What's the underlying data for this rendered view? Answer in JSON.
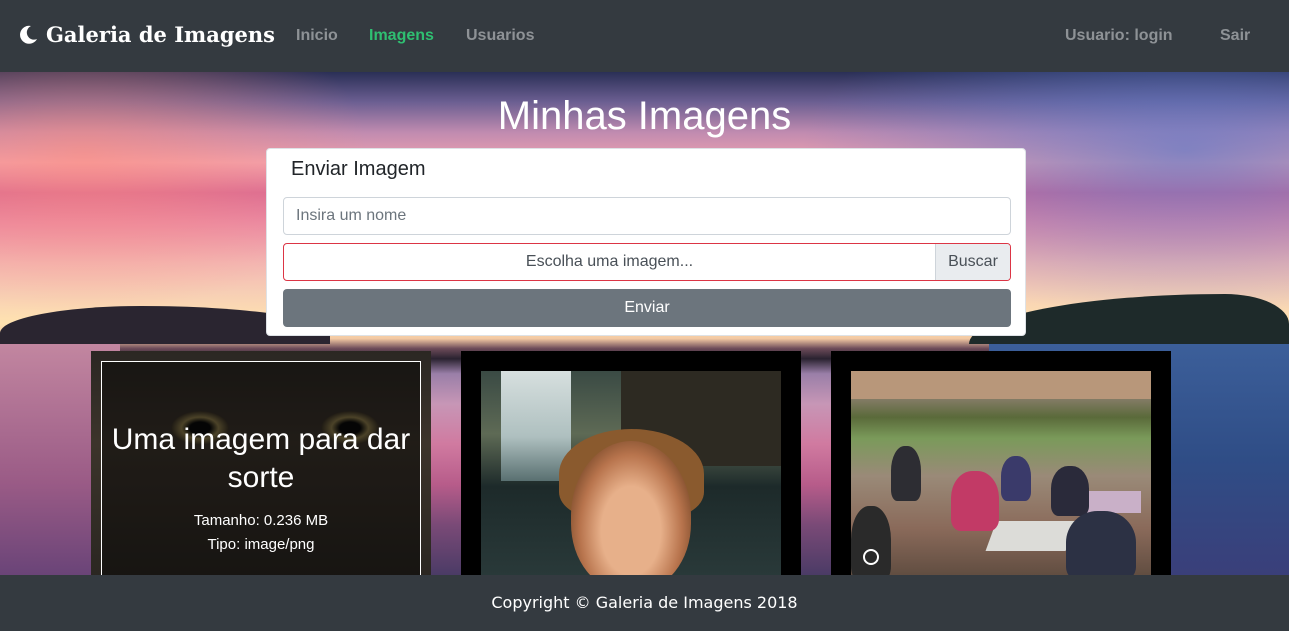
{
  "navbar": {
    "brand": "Galeria de Imagens",
    "brand_icon": "moon-icon",
    "links": [
      {
        "label": "Inicio",
        "active": false
      },
      {
        "label": "Imagens",
        "active": true
      },
      {
        "label": "Usuarios",
        "active": false
      }
    ],
    "user_label": "Usuario: login",
    "logout_label": "Sair",
    "active_color": "#2fbf71"
  },
  "main": {
    "title": "Minhas Imagens",
    "upload": {
      "title": "Enviar Imagem",
      "name_placeholder": "Insira um nome",
      "file_label": "Escolha uma imagem...",
      "browse_label": "Buscar",
      "submit_label": "Enviar"
    },
    "gallery": [
      {
        "caption_title": "Uma imagem para dar sorte",
        "size_text": "Tamanho: 0.236 MB",
        "type_text": "Tipo: image/png"
      },
      {},
      {}
    ]
  },
  "footer": {
    "text": "Copyright © Galeria de Imagens 2018"
  }
}
